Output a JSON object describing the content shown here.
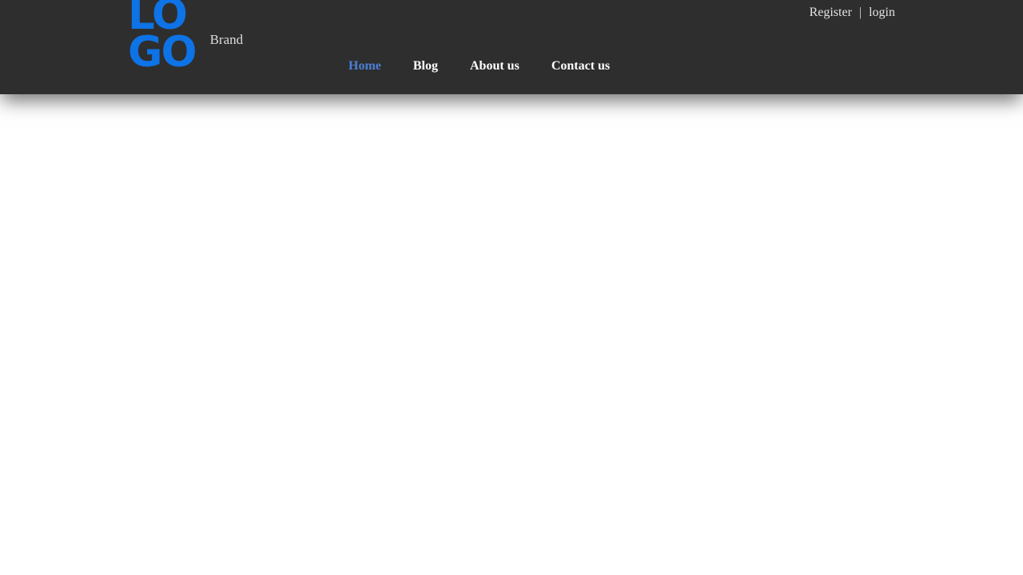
{
  "header": {
    "background_color": "#2e2e2e",
    "logo": {
      "line1": "LO",
      "line2": "GO",
      "color": "#0d73e6"
    },
    "brand_name": "Brand",
    "account": {
      "register_label": "Register",
      "separator": "|",
      "login_label": "login"
    },
    "nav": {
      "active_color": "#4a80d6",
      "items": [
        {
          "label": "Home",
          "active": true
        },
        {
          "label": "Blog",
          "active": false
        },
        {
          "label": "About us",
          "active": false
        },
        {
          "label": "Contact us",
          "active": false
        }
      ]
    }
  },
  "body": {
    "background_color": "#ffffff"
  }
}
